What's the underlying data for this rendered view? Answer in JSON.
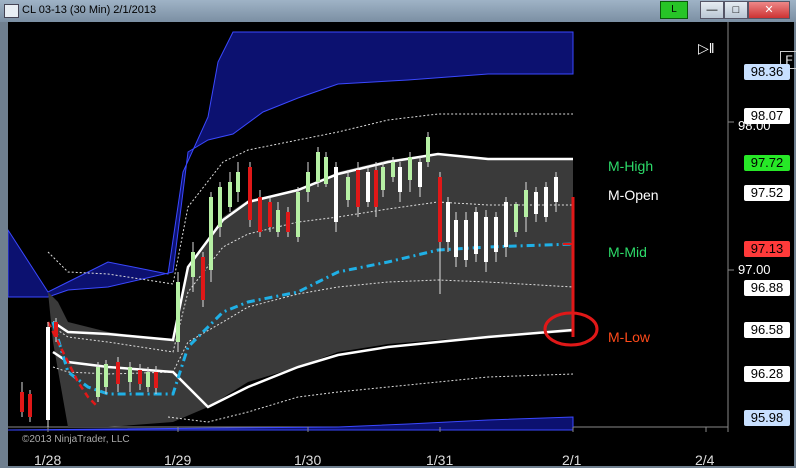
{
  "window": {
    "title": "CL 03-13 (30 Min)  2/1/2013",
    "link_button": "L",
    "minimize": "—",
    "maximize": "□",
    "close": "✕"
  },
  "chart": {
    "f_button": "F",
    "play_icon": "▷‖",
    "copyright": "©2013 NinjaTrader, LLC"
  },
  "price_labels": [
    {
      "value": "98.36",
      "bg": "#c8e0ff",
      "color": "#000"
    },
    {
      "value": "98.07",
      "bg": "#ffffff",
      "color": "#000"
    },
    {
      "value": "97.72",
      "bg": "#27e827",
      "color": "#000"
    },
    {
      "value": "97.52",
      "bg": "#ffffff",
      "color": "#000"
    },
    {
      "value": "97.13",
      "bg": "#ff3a3a",
      "color": "#000"
    },
    {
      "value": "96.88",
      "bg": "#ffffff",
      "color": "#000"
    },
    {
      "value": "96.58",
      "bg": "#ffffff",
      "color": "#000"
    },
    {
      "value": "96.28",
      "bg": "#ffffff",
      "color": "#000"
    },
    {
      "value": "95.98",
      "bg": "#c8e0ff",
      "color": "#000"
    }
  ],
  "axis_ticks": [
    "98.00",
    "97.00"
  ],
  "dates": [
    "1/28",
    "1/29",
    "1/30",
    "1/31",
    "2/1",
    "2/4"
  ],
  "levels": [
    {
      "name": "M-High",
      "color": "#2ddc6a"
    },
    {
      "name": "M-Open",
      "color": "#ffffff"
    },
    {
      "name": "M-Mid",
      "color": "#2ddc6a"
    },
    {
      "name": "M-Low",
      "color": "#ff4a1a"
    }
  ]
}
